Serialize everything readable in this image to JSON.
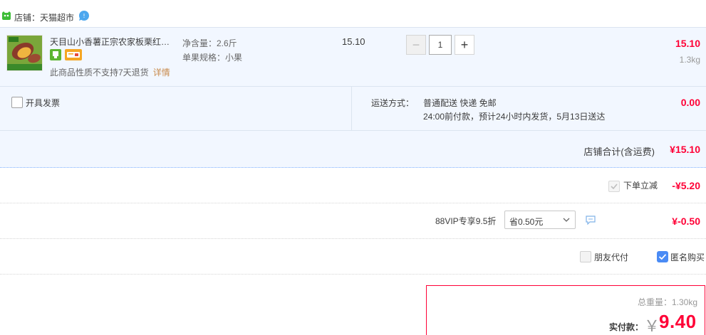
{
  "shop": {
    "label": "店铺：天猫超市",
    "icon": "tmall-cat-icon",
    "wangwang_icon": "chat-bubble-icon"
  },
  "item": {
    "title": "天目山小香薯正宗农家板栗红薯…",
    "attr_net": "净含量：2.6斤",
    "attr_spec": "单果规格：小果",
    "unit_price": "15.10",
    "quantity": "1",
    "minus_label": "−",
    "plus_label": "+",
    "subtotal": "15.10",
    "weight": "1.3kg",
    "return_note": "此商品性质不支持7天退货",
    "return_link": "详情",
    "badges": [
      "store-badge-icon",
      "card-badge-icon"
    ]
  },
  "invoice": {
    "label": "开具发票",
    "checked": false
  },
  "delivery": {
    "label": "运送方式：",
    "method": "普通配送 快递 免邮",
    "time": "24:00前付款，预计24小时内发货，5月13日送达",
    "fee": "0.00"
  },
  "shop_total": {
    "label": "店铺合计(含运费)",
    "value": "¥15.10"
  },
  "discount": {
    "label": "下单立减",
    "value": "-¥5.20",
    "checked": true
  },
  "vip": {
    "label": "88VIP专享9.5折",
    "select_value": "省0.50元",
    "value": "¥-0.50"
  },
  "options": {
    "friend_pay_label": "朋友代付",
    "friend_pay_checked": false,
    "anonymous_label": "匿名购买",
    "anonymous_checked": true
  },
  "payment": {
    "total_weight": "总重量：1.30kg",
    "label": "实付款：",
    "currency": "￥",
    "value": "9.40"
  },
  "colors": {
    "accent_red": "#ff0036",
    "row_blue": "#f2f7ff",
    "check_blue": "#4a8bf5",
    "link_orange": "#c88a4b"
  }
}
